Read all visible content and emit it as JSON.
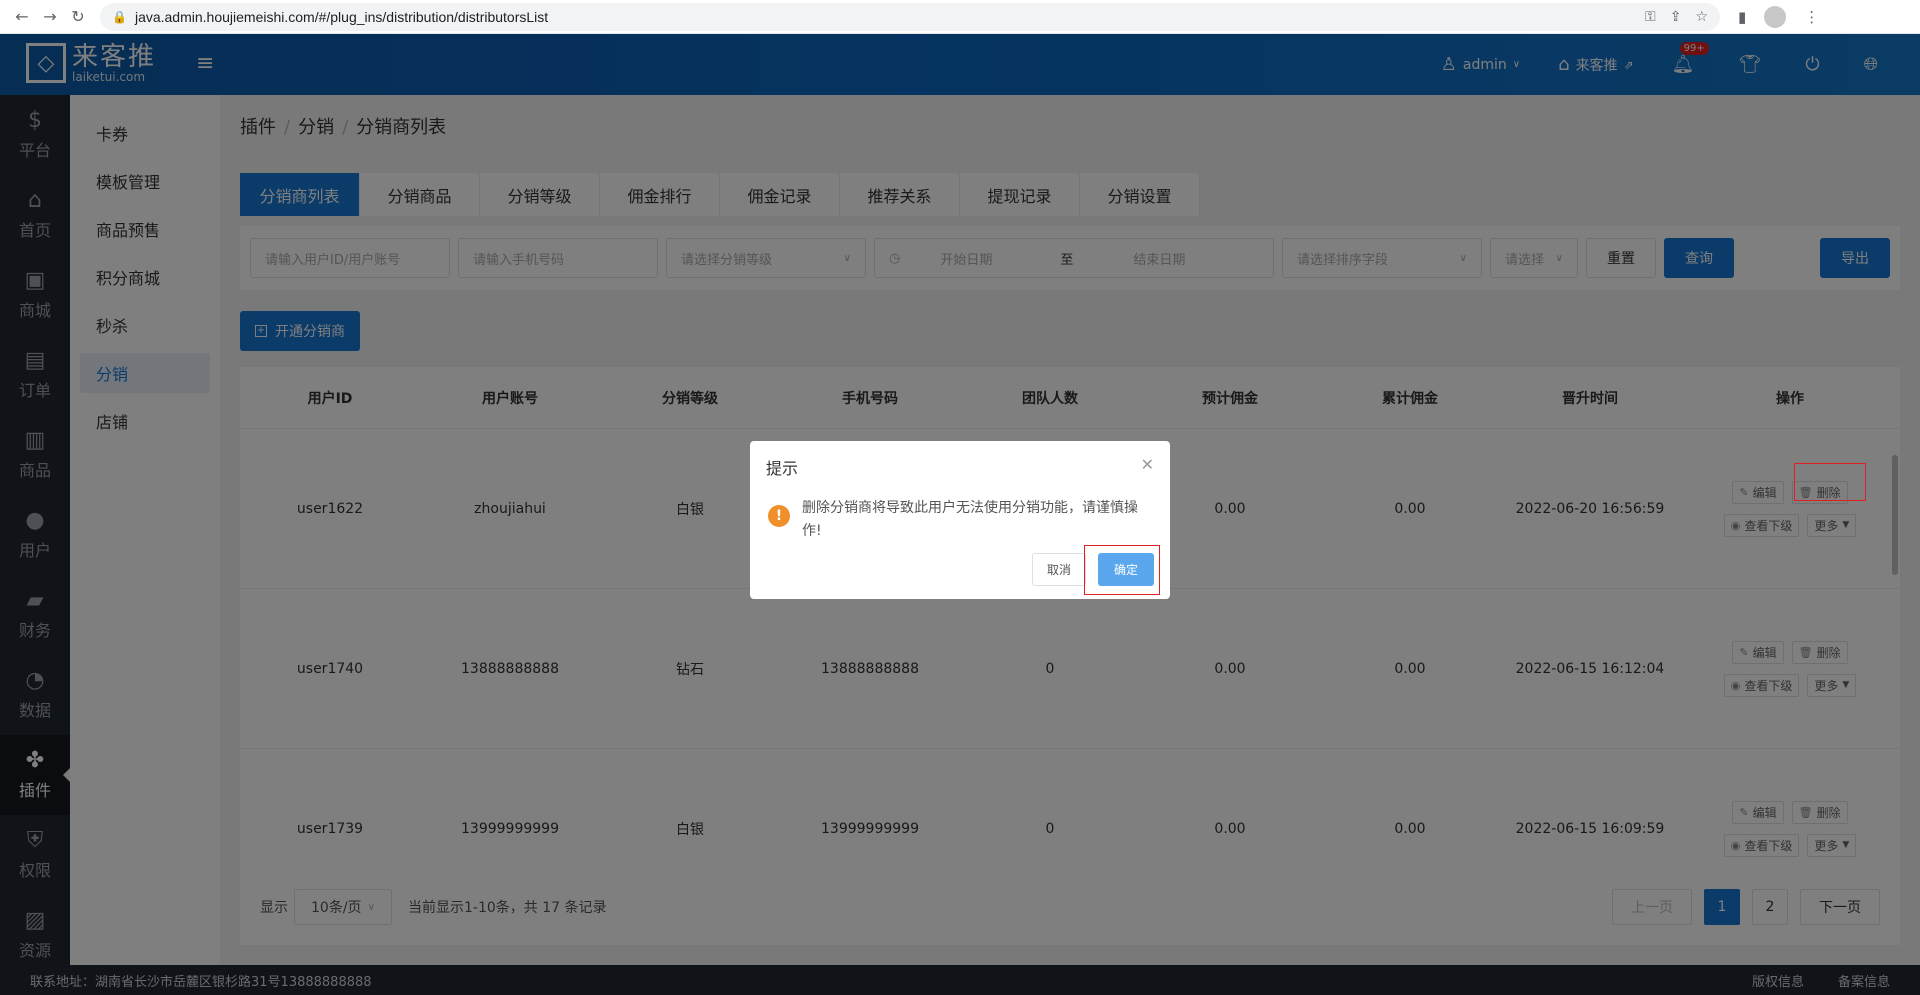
{
  "browser": {
    "url": "java.admin.houjiemeishi.com/#/plug_ins/distribution/distributorsList"
  },
  "header": {
    "logo_cn": "来客推",
    "logo_en": "laiketui.com",
    "user": "admin",
    "store": "来客推",
    "notification_badge": "99+"
  },
  "rail": {
    "items": [
      {
        "label": "平台",
        "icon": "$"
      },
      {
        "label": "首页",
        "icon": "⌂"
      },
      {
        "label": "商城",
        "icon": "▣"
      },
      {
        "label": "订单",
        "icon": "▤"
      },
      {
        "label": "商品",
        "icon": "▥"
      },
      {
        "label": "用户",
        "icon": "●"
      },
      {
        "label": "财务",
        "icon": "▰"
      },
      {
        "label": "数据",
        "icon": "◔"
      },
      {
        "label": "插件",
        "icon": "✤"
      },
      {
        "label": "权限",
        "icon": "⛨"
      },
      {
        "label": "资源",
        "icon": "▨"
      }
    ]
  },
  "submenu": {
    "items": [
      "卡券",
      "模板管理",
      "商品预售",
      "积分商城",
      "秒杀",
      "分销",
      "店铺"
    ]
  },
  "breadcrumb": {
    "a": "插件",
    "b": "分销",
    "c": "分销商列表"
  },
  "tabs": [
    "分销商列表",
    "分销商品",
    "分销等级",
    "佣金排行",
    "佣金记录",
    "推荐关系",
    "提现记录",
    "分销设置"
  ],
  "filters": {
    "user_placeholder": "请输入用户ID/用户账号",
    "phone_placeholder": "请输入手机号码",
    "level_placeholder": "请选择分销等级",
    "start_date": "开始日期",
    "to": "至",
    "end_date": "结束日期",
    "sort_placeholder": "请选择排序字段",
    "order_placeholder": "请选择",
    "reset": "重置",
    "search": "查询",
    "export": "导出"
  },
  "add_button": "开通分销商",
  "table": {
    "headers": [
      "用户ID",
      "用户账号",
      "分销等级",
      "手机号码",
      "团队人数",
      "预计佣金",
      "累计佣金",
      "晋升时间",
      "操作"
    ],
    "ops": {
      "edit": "编辑",
      "delete": "删除",
      "view_sub": "查看下级",
      "more": "更多"
    },
    "rows": [
      {
        "id": "user1622",
        "account": "zhoujiahui",
        "level": "白银",
        "phone": "",
        "team": "",
        "est": "0.00",
        "total": "0.00",
        "time": "2022-06-20 16:56:59"
      },
      {
        "id": "user1740",
        "account": "13888888888",
        "level": "钻石",
        "phone": "13888888888",
        "team": "0",
        "est": "0.00",
        "total": "0.00",
        "time": "2022-06-15 16:12:04"
      },
      {
        "id": "user1739",
        "account": "13999999999",
        "level": "白银",
        "phone": "13999999999",
        "team": "0",
        "est": "0.00",
        "total": "0.00",
        "time": "2022-06-15 16:09:59"
      }
    ]
  },
  "pager": {
    "show": "显示",
    "per_page": "10条/页",
    "info": "当前显示1-10条，共 17 条记录",
    "prev": "上一页",
    "p1": "1",
    "p2": "2",
    "next": "下一页"
  },
  "footer": {
    "address": "联系地址：湖南省长沙市岳麓区银杉路31号13888888888",
    "copyright": "版权信息",
    "icp": "备案信息"
  },
  "dialog": {
    "title": "提示",
    "message": "删除分销商将导致此用户无法使用分销功能，请谨慎操作!",
    "cancel": "取消",
    "confirm": "确定"
  },
  "colors": {
    "primary": "#1677d2",
    "header": "#0b66c1",
    "rail": "#20262e",
    "warning": "#f0902a",
    "highlight": "#e02020"
  }
}
